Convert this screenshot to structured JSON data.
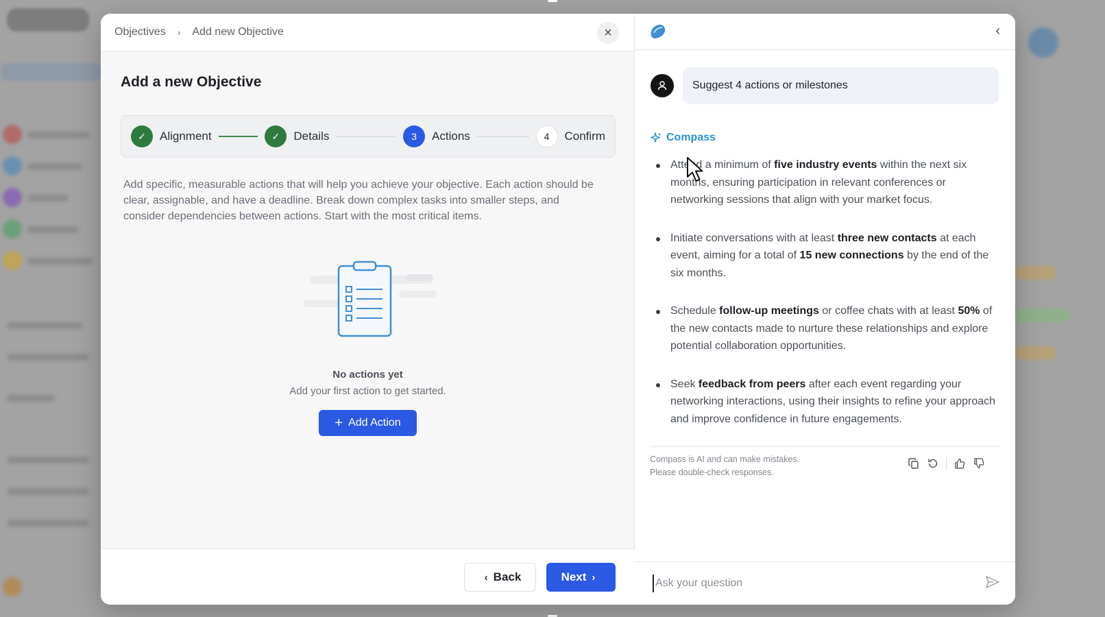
{
  "breadcrumb": {
    "root": "Objectives",
    "separator": "›",
    "current": "Add new Objective"
  },
  "close_icon": "×",
  "page_title": "Add a new Objective",
  "stepper": {
    "steps": [
      {
        "label": "Alignment",
        "state": "done",
        "marker": "✓"
      },
      {
        "label": "Details",
        "state": "done",
        "marker": "✓"
      },
      {
        "label": "Actions",
        "state": "active",
        "marker": "3"
      },
      {
        "label": "Confirm",
        "state": "todo",
        "marker": "4"
      }
    ]
  },
  "description": "Add specific, measurable actions that will help you achieve your objective. Each action should be clear, assignable, and have a deadline. Break down complex tasks into smaller steps, and consider dependencies between actions. Start with the most critical items.",
  "empty_state": {
    "title": "No actions yet",
    "subtitle": "Add your first action to get started.",
    "button": "Add Action",
    "button_icon": "+"
  },
  "footer": {
    "back": "Back",
    "next": "Next",
    "back_icon": "‹",
    "next_icon": "›"
  },
  "chat": {
    "collapse_icon": "‹",
    "user_message": "Suggest 4 actions or milestones",
    "assistant_name": "Compass",
    "answer": [
      [
        {
          "t": "Attend a minimum of "
        },
        {
          "t": "five industry events",
          "b": true
        },
        {
          "t": " within the next six months, ensuring participation in relevant conferences or networking sessions that align with your market focus."
        }
      ],
      [
        {
          "t": "Initiate conversations with at least "
        },
        {
          "t": "three new contacts",
          "b": true
        },
        {
          "t": " at each event, aiming for a total of "
        },
        {
          "t": "15 new connections",
          "b": true
        },
        {
          "t": " by the end of the six months."
        }
      ],
      [
        {
          "t": "Schedule "
        },
        {
          "t": "follow-up meetings",
          "b": true
        },
        {
          "t": " or coffee chats with at least "
        },
        {
          "t": "50%",
          "b": true
        },
        {
          "t": " of the new contacts made to nurture these relationships and explore potential collaboration opportunities."
        }
      ],
      [
        {
          "t": "Seek "
        },
        {
          "t": "feedback from peers",
          "b": true
        },
        {
          "t": " after each event regarding your networking interactions, using their insights to refine your approach and improve confidence in future engagements."
        }
      ]
    ],
    "disclaimer_line1": "Compass is AI and can make mistakes.",
    "disclaimer_line2": "Please double-check responses.",
    "feedback_icons": [
      "copy-icon",
      "regenerate-icon",
      "thumbs-up-icon",
      "thumbs-down-icon"
    ],
    "input_placeholder": "Ask your question",
    "input_value": ""
  },
  "colors": {
    "accent": "#2b59e3",
    "success": "#2f7a3e",
    "assistant": "#2a8fd6"
  }
}
